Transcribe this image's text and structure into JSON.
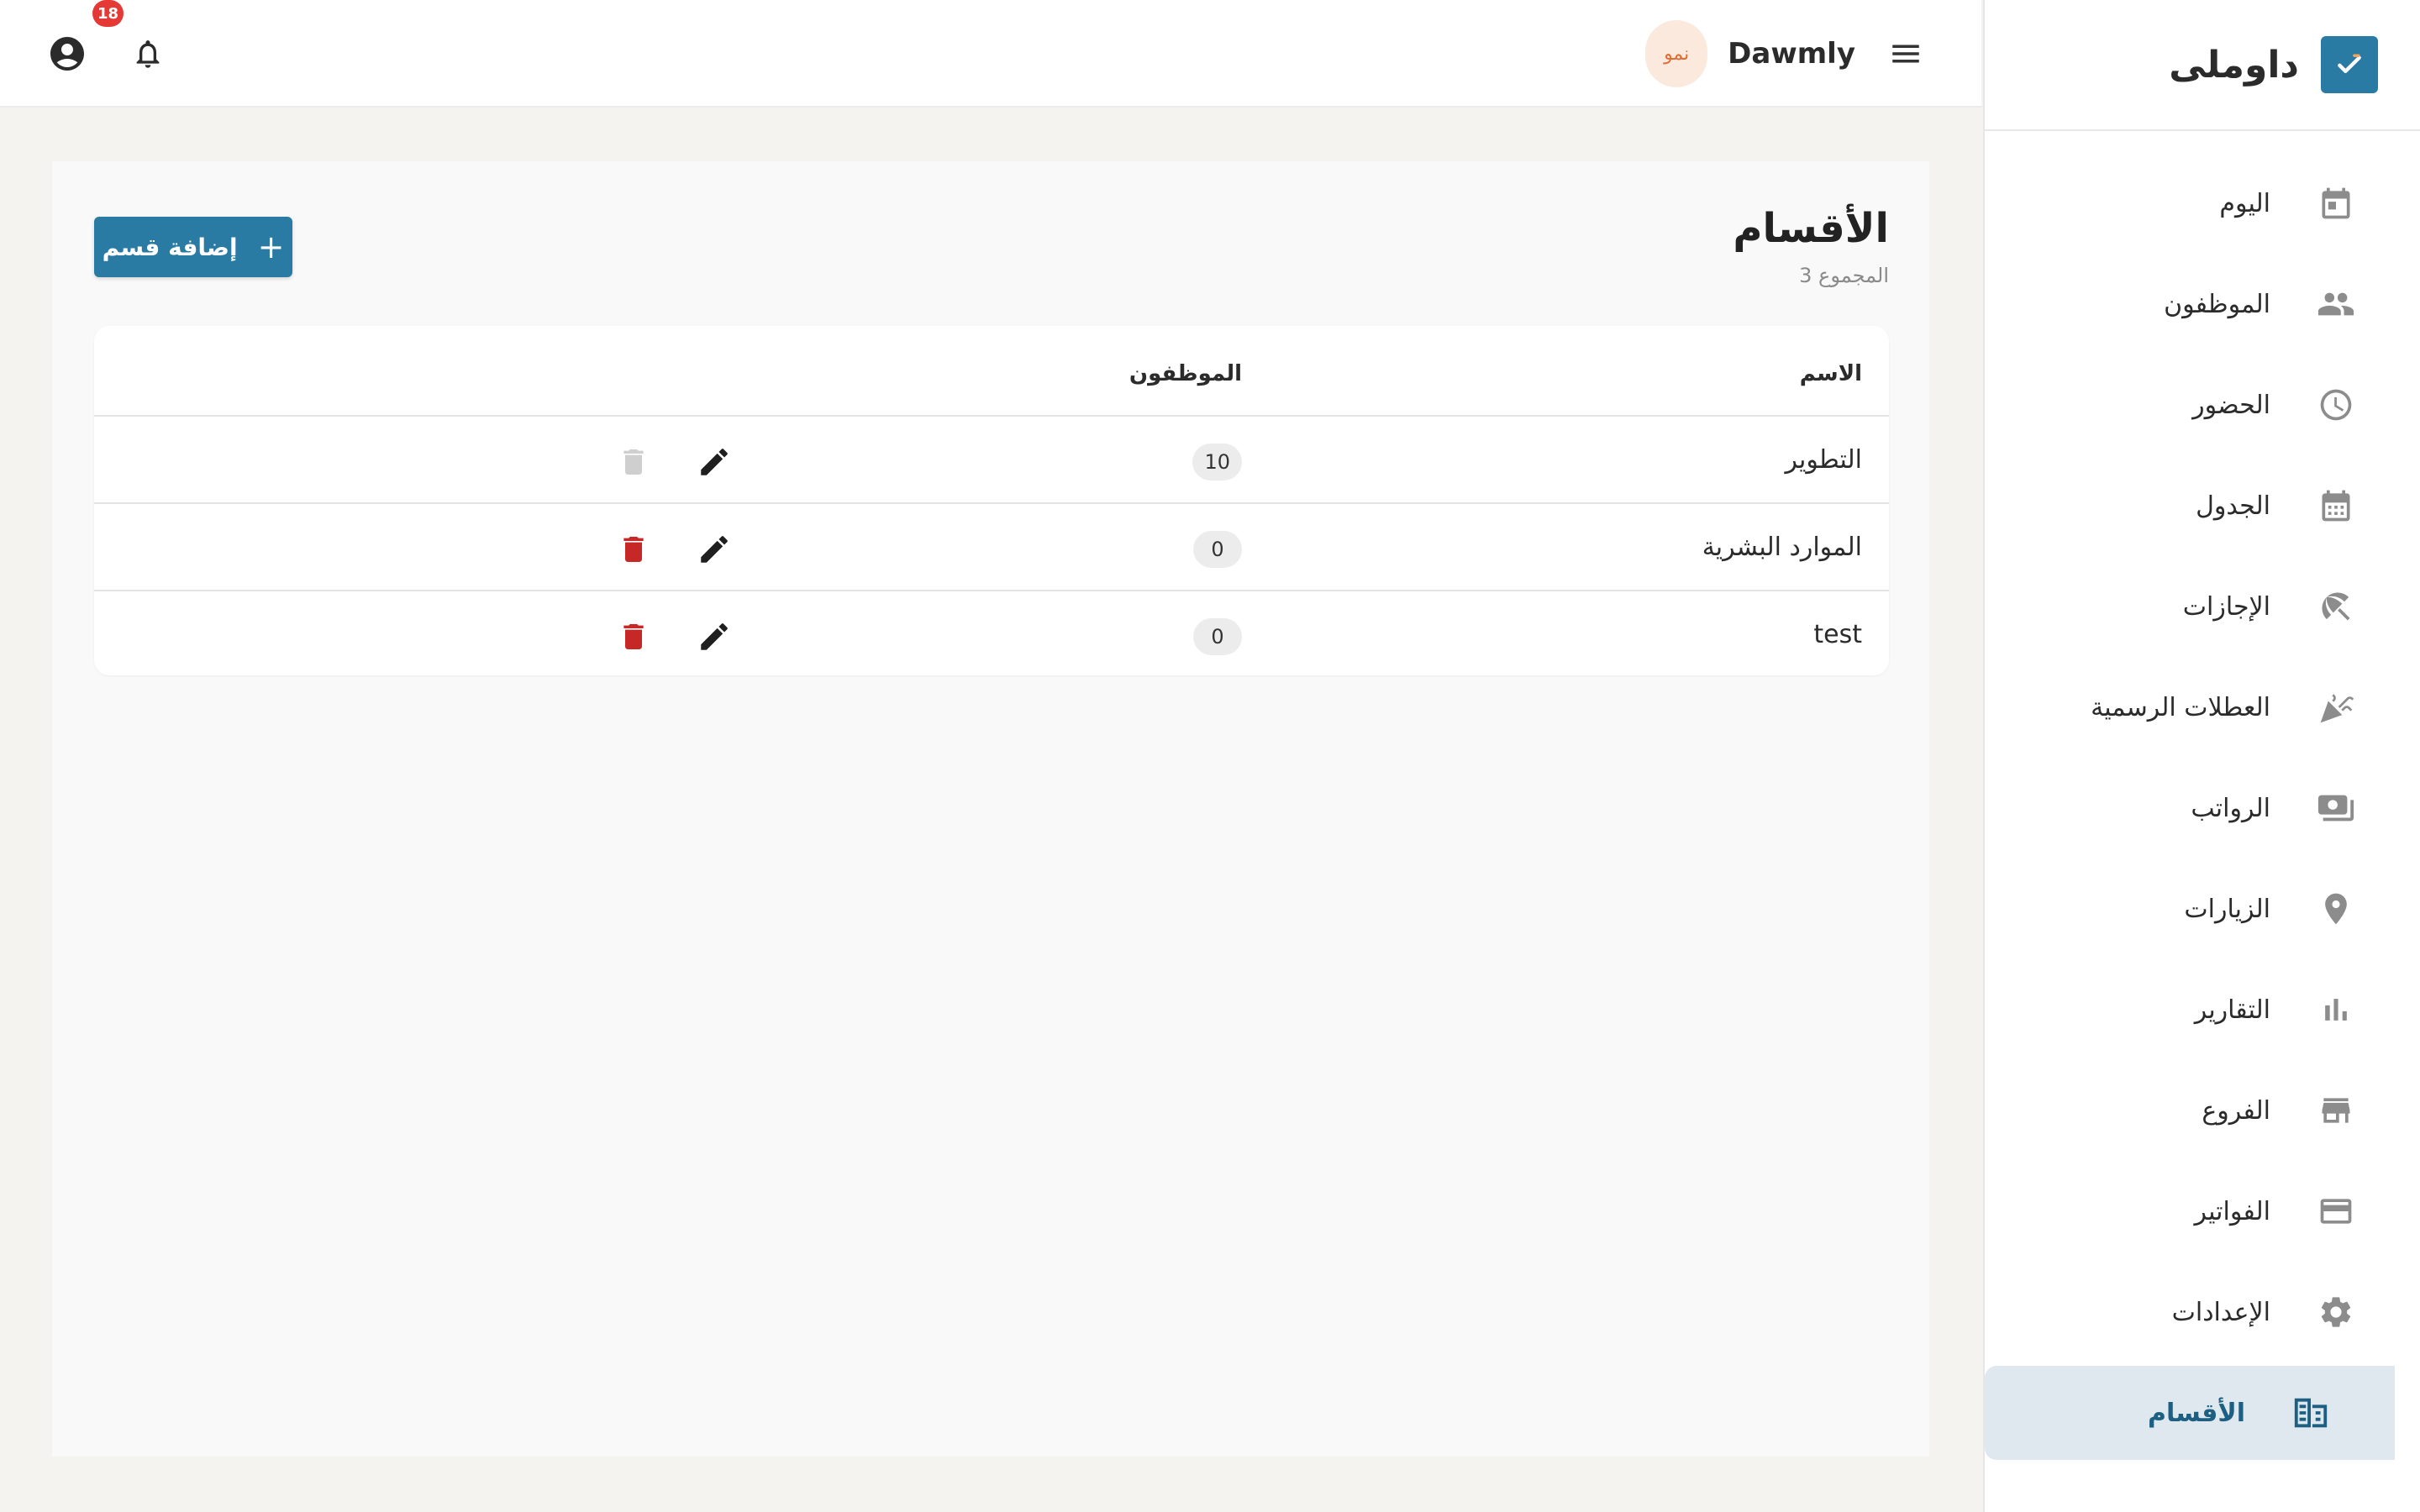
{
  "app": {
    "brand_name": "داوملى",
    "workspace_name": "Dawmly",
    "workspace_avatar_text": "نمو",
    "notification_count": "18",
    "accent_color": "#2a7ba4",
    "danger_color": "#c62828"
  },
  "sidebar": {
    "items": [
      {
        "label": "اليوم",
        "icon": "today-calendar-icon"
      },
      {
        "label": "الموظفون",
        "icon": "people-icon"
      },
      {
        "label": "الحضور",
        "icon": "clock-icon"
      },
      {
        "label": "الجدول",
        "icon": "calendar-grid-icon"
      },
      {
        "label": "الإجازات",
        "icon": "beach-umbrella-icon"
      },
      {
        "label": "العطلات الرسمية",
        "icon": "celebration-icon"
      },
      {
        "label": "الرواتب",
        "icon": "payments-icon"
      },
      {
        "label": "الزيارات",
        "icon": "location-pin-icon"
      },
      {
        "label": "التقارير",
        "icon": "bar-chart-icon"
      },
      {
        "label": "الفروع",
        "icon": "store-icon"
      },
      {
        "label": "الفواتير",
        "icon": "credit-card-icon"
      },
      {
        "label": "الإعدادات",
        "icon": "gear-icon"
      },
      {
        "label": "الأقسام",
        "icon": "departments-icon",
        "active": true
      }
    ]
  },
  "page": {
    "title": "الأقسام",
    "subtitle": "3 المجموع",
    "add_button_label": "إضافة قسم"
  },
  "table": {
    "columns": {
      "name": "الاسم",
      "employees": "الموظفون"
    },
    "rows": [
      {
        "name": "التطوير",
        "employees": "10",
        "delete_enabled": false
      },
      {
        "name": "الموارد البشرية",
        "employees": "0",
        "delete_enabled": true
      },
      {
        "name": "test",
        "employees": "0",
        "delete_enabled": true
      }
    ]
  }
}
